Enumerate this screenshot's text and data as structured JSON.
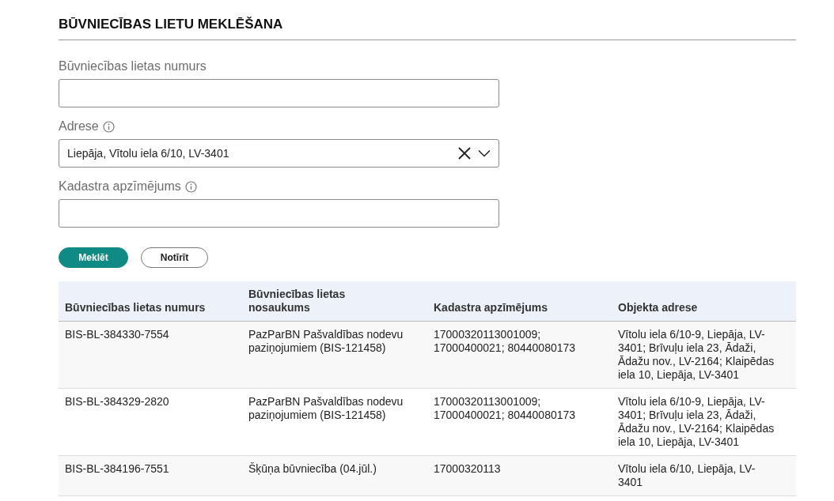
{
  "title": "BŪVNIECĪBAS LIETU MEKLĒŠANA",
  "fields": [
    {
      "kind": "text",
      "label": "Būvniecības lietas numurs",
      "info": false
    },
    {
      "kind": "select",
      "label": "Adrese",
      "info": true,
      "value": "Liepāja, Vītolu iela 6/10, LV-3401"
    },
    {
      "kind": "text",
      "label": "Kadastra apzīmējums",
      "info": true
    }
  ],
  "buttons": [
    {
      "label": "Meklēt",
      "kind": "primary"
    },
    {
      "label": "Notīrīt",
      "kind": "secondary"
    }
  ],
  "table": {
    "columns": [
      "Būvniecības lietas numurs",
      "Būvniecības lietas nosaukums",
      "Kadastra apzīmējums",
      "Objekta adrese"
    ],
    "rows": [
      [
        "BIS-BL-384330-7554",
        "PazParBN Pašvaldības nodevu paziņojumiem (BIS-121458)",
        "17000320113001009; 17000400021; 80440080173",
        "Vītolu iela 6/10-9, Liepāja, LV-3401; Brīvuļu iela 23, Ādaži, Ādažu nov., LV-2164; Klaipēdas iela 10, Liepāja, LV-3401"
      ],
      [
        "BIS-BL-384329-2820",
        "PazParBN Pašvaldības nodevu paziņojumiem (BIS-121458)",
        "17000320113001009; 17000400021; 80440080173",
        "Vītolu iela 6/10-9, Liepāja, LV-3401; Brīvuļu iela 23, Ādaži, Ādažu nov., LV-2164; Klaipēdas iela 10, Liepāja, LV-3401"
      ],
      [
        "BIS-BL-384196-7551",
        "Šķūņa būvniecība (04.jūl.)",
        "17000320113",
        "Vītolu iela 6/10, Liepāja, LV-3401"
      ]
    ]
  }
}
